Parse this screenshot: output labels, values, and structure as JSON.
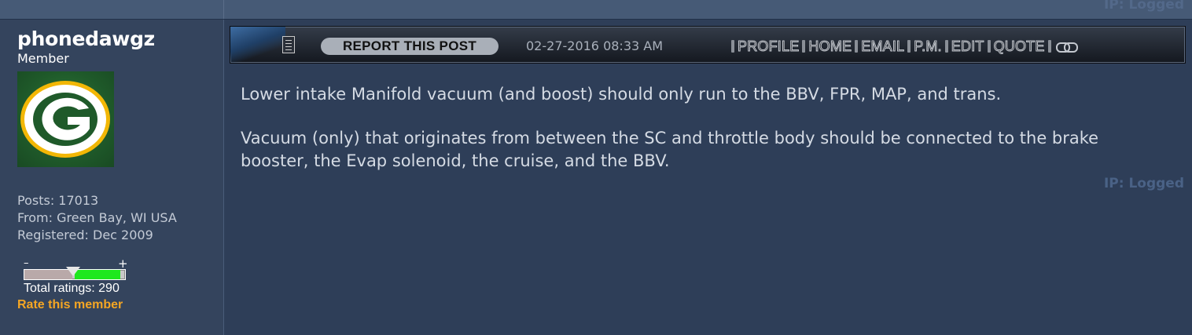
{
  "prev_post": {
    "ip_label": "IP: Logged"
  },
  "user": {
    "name": "phonedawgz",
    "rank": "Member",
    "avatar": "green-bay-packers-G-logo",
    "posts": "Posts: 17013",
    "from": "From: Green Bay, WI USA",
    "registered": "Registered: Dec 2009",
    "rating": {
      "minus_symbol": "–",
      "plus_symbol": "+",
      "total": "Total ratings: 290",
      "rate_link": "Rate this member",
      "positive_fraction": 0.45,
      "negative_fraction": 0.48
    }
  },
  "post": {
    "report_button": "REPORT THIS POST",
    "date": "02-27-2016 08:33 AM",
    "nav": {
      "profile": "PROFILE",
      "home": "HOME",
      "email": "EMAIL",
      "pm": "P.M.",
      "edit": "EDIT",
      "quote": "QUOTE"
    },
    "body": [
      "Lower intake Manifold vacuum (and boost) should only run to the BBV, FPR, MAP, and trans.",
      "Vacuum (only) that originates from between the SC and throttle body should be connected to the brake booster, the Evap solenoid, the cruise, and the BBV."
    ],
    "ip_label": "IP: Logged"
  },
  "colors": {
    "background": "#2e3e58",
    "user_column": "#34445d",
    "rate_link": "#f5a623",
    "positive_rating": "#1ee81e"
  }
}
